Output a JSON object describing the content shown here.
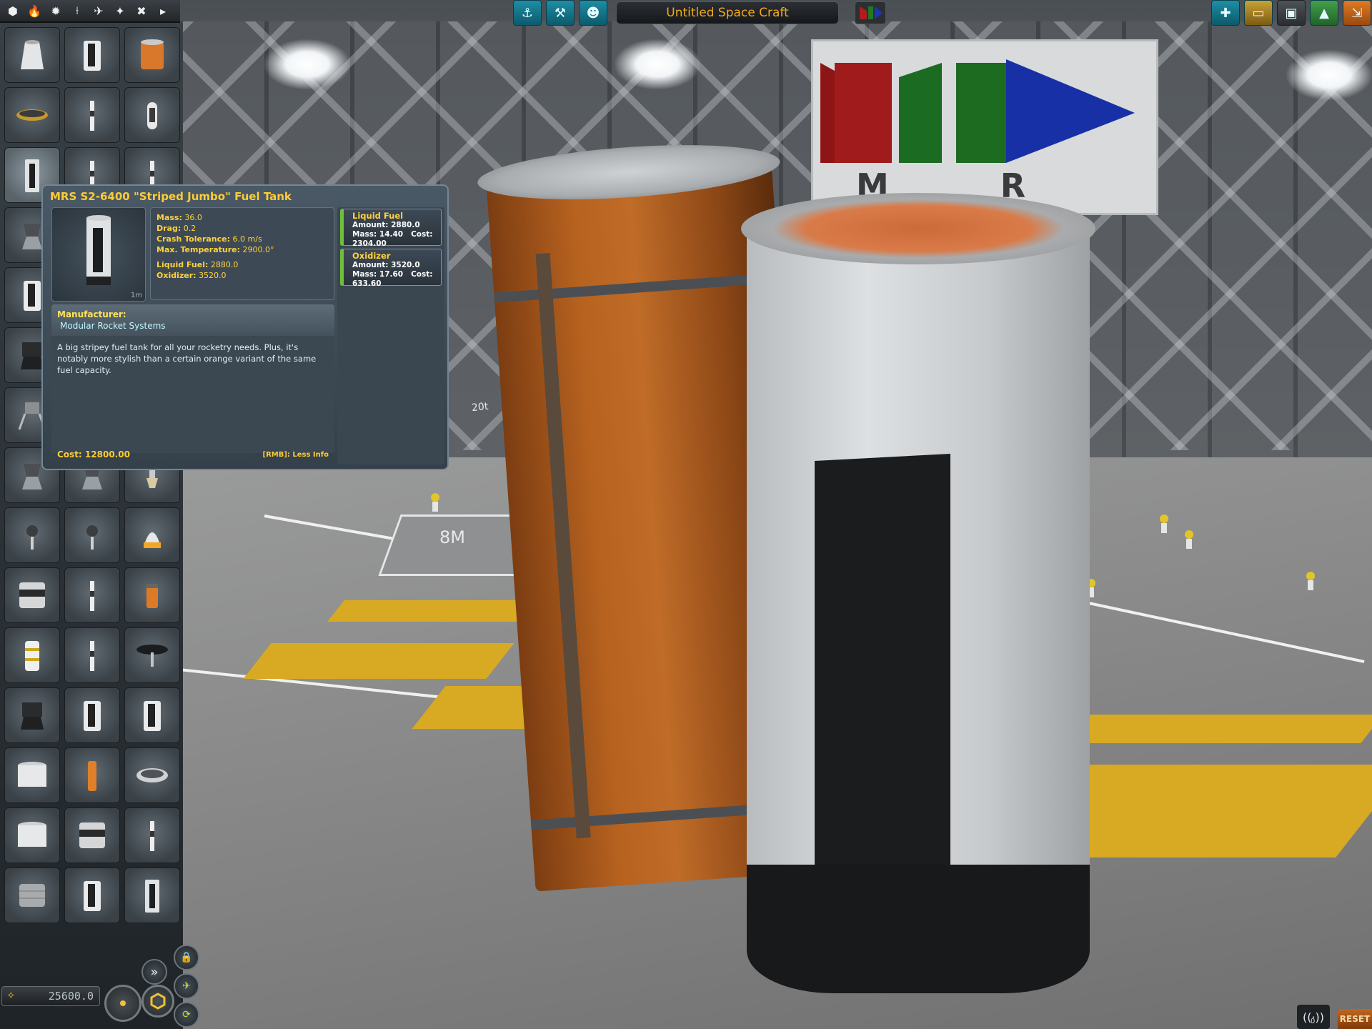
{
  "app": {
    "craft_name": "Untitled Space Craft"
  },
  "toolbar": {
    "left_categories": [
      {
        "icon": "pods-icon",
        "glyph": "⬢"
      },
      {
        "icon": "propulsion-icon",
        "glyph": "🔥"
      },
      {
        "icon": "control-icon",
        "glyph": "✹"
      },
      {
        "icon": "structural-icon",
        "glyph": "⟊"
      },
      {
        "icon": "aero-icon",
        "glyph": "✈"
      },
      {
        "icon": "utility-icon",
        "glyph": "✦"
      },
      {
        "icon": "science-icon",
        "glyph": "✖"
      },
      {
        "icon": "more-icon",
        "glyph": "▸"
      }
    ],
    "center_buttons": [
      {
        "icon": "construction-mode-icon",
        "glyph": "⚓"
      },
      {
        "icon": "action-groups-icon",
        "glyph": "⚒"
      },
      {
        "icon": "crew-icon",
        "glyph": "☻"
      }
    ],
    "right_buttons": [
      {
        "icon": "new-craft-icon",
        "glyph": "✚",
        "style": ""
      },
      {
        "icon": "load-craft-icon",
        "glyph": "▭",
        "style": "folder"
      },
      {
        "icon": "save-craft-icon",
        "glyph": "▣",
        "style": "gray"
      },
      {
        "icon": "launch-icon",
        "glyph": "▲",
        "style": "green"
      },
      {
        "icon": "exit-icon",
        "glyph": "⇲",
        "style": "orange"
      }
    ],
    "brand_colors": {
      "teal": "#1d8ea4",
      "gold": "#f2a81c"
    }
  },
  "parts": [
    {
      "shape": "cone"
    },
    {
      "shape": "tank-white"
    },
    {
      "shape": "tank-orange"
    },
    {
      "shape": "disk"
    },
    {
      "shape": "slim"
    },
    {
      "shape": "capsule"
    },
    {
      "shape": "tank-striped"
    },
    {
      "shape": "slim"
    },
    {
      "shape": "slim"
    },
    {
      "shape": "engine"
    },
    {
      "shape": "blank"
    },
    {
      "shape": "blank"
    },
    {
      "shape": "tank-white"
    },
    {
      "shape": "blank"
    },
    {
      "shape": "blank"
    },
    {
      "shape": "engine-dark"
    },
    {
      "shape": "blank"
    },
    {
      "shape": "blank"
    },
    {
      "shape": "lander"
    },
    {
      "shape": "blank"
    },
    {
      "shape": "blank"
    },
    {
      "shape": "engine"
    },
    {
      "shape": "engine"
    },
    {
      "shape": "nozzle"
    },
    {
      "shape": "probe"
    },
    {
      "shape": "probe"
    },
    {
      "shape": "nose"
    },
    {
      "shape": "drum"
    },
    {
      "shape": "slim"
    },
    {
      "shape": "orange-small"
    },
    {
      "shape": "battery"
    },
    {
      "shape": "slim"
    },
    {
      "shape": "dish"
    },
    {
      "shape": "engine-dark"
    },
    {
      "shape": "tank-white"
    },
    {
      "shape": "tank-white"
    },
    {
      "shape": "tank-wide"
    },
    {
      "shape": "orange-slim"
    },
    {
      "shape": "ring"
    },
    {
      "shape": "tank-wide"
    },
    {
      "shape": "drum"
    },
    {
      "shape": "slim"
    },
    {
      "shape": "mesh"
    },
    {
      "shape": "tank-white"
    },
    {
      "shape": "tank-striped"
    }
  ],
  "part_info": {
    "title": "MRS S2-6400 \"Striped Jumbo\" Fuel Tank",
    "thumb_size_label": "1m",
    "stats": {
      "mass_label": "Mass:",
      "mass_value": "36.0",
      "drag_label": "Drag:",
      "drag_value": "0.2",
      "crash_label": "Crash Tolerance:",
      "crash_value": "6.0 m/s",
      "temp_label": "Max. Temperature:",
      "temp_value": "2900.0°",
      "lf_label": "Liquid Fuel:",
      "lf_value": "2880.0",
      "ox_label": "Oxidizer:",
      "ox_value": "3520.0"
    },
    "resources": [
      {
        "name": "Liquid Fuel",
        "amount_label": "Amount:",
        "amount": "2880.0",
        "mass_label": "Mass:",
        "mass": "14.40",
        "cost_label": "Cost:",
        "cost": "2304.00"
      },
      {
        "name": "Oxidizer",
        "amount_label": "Amount:",
        "amount": "3520.0",
        "mass_label": "Mass:",
        "mass": "17.60",
        "cost_label": "Cost:",
        "cost": "633.60"
      }
    ],
    "manufacturer_label": "Manufacturer:",
    "manufacturer": "Modular Rocket Systems",
    "description": "A big stripey fuel tank for all your rocketry needs. Plus, it's notably more stylish than a certain orange variant of the same fuel capacity.",
    "cost_label": "Cost:",
    "cost": "12800.00",
    "rmb_hint": "[RMB]: Less Info"
  },
  "scene": {
    "banner_text": "M R S",
    "floor_marking": "8M",
    "sign_marking": "20t"
  },
  "bottom": {
    "funds": "25600.0",
    "antenna_count": "0",
    "reset_label": "RESET"
  }
}
